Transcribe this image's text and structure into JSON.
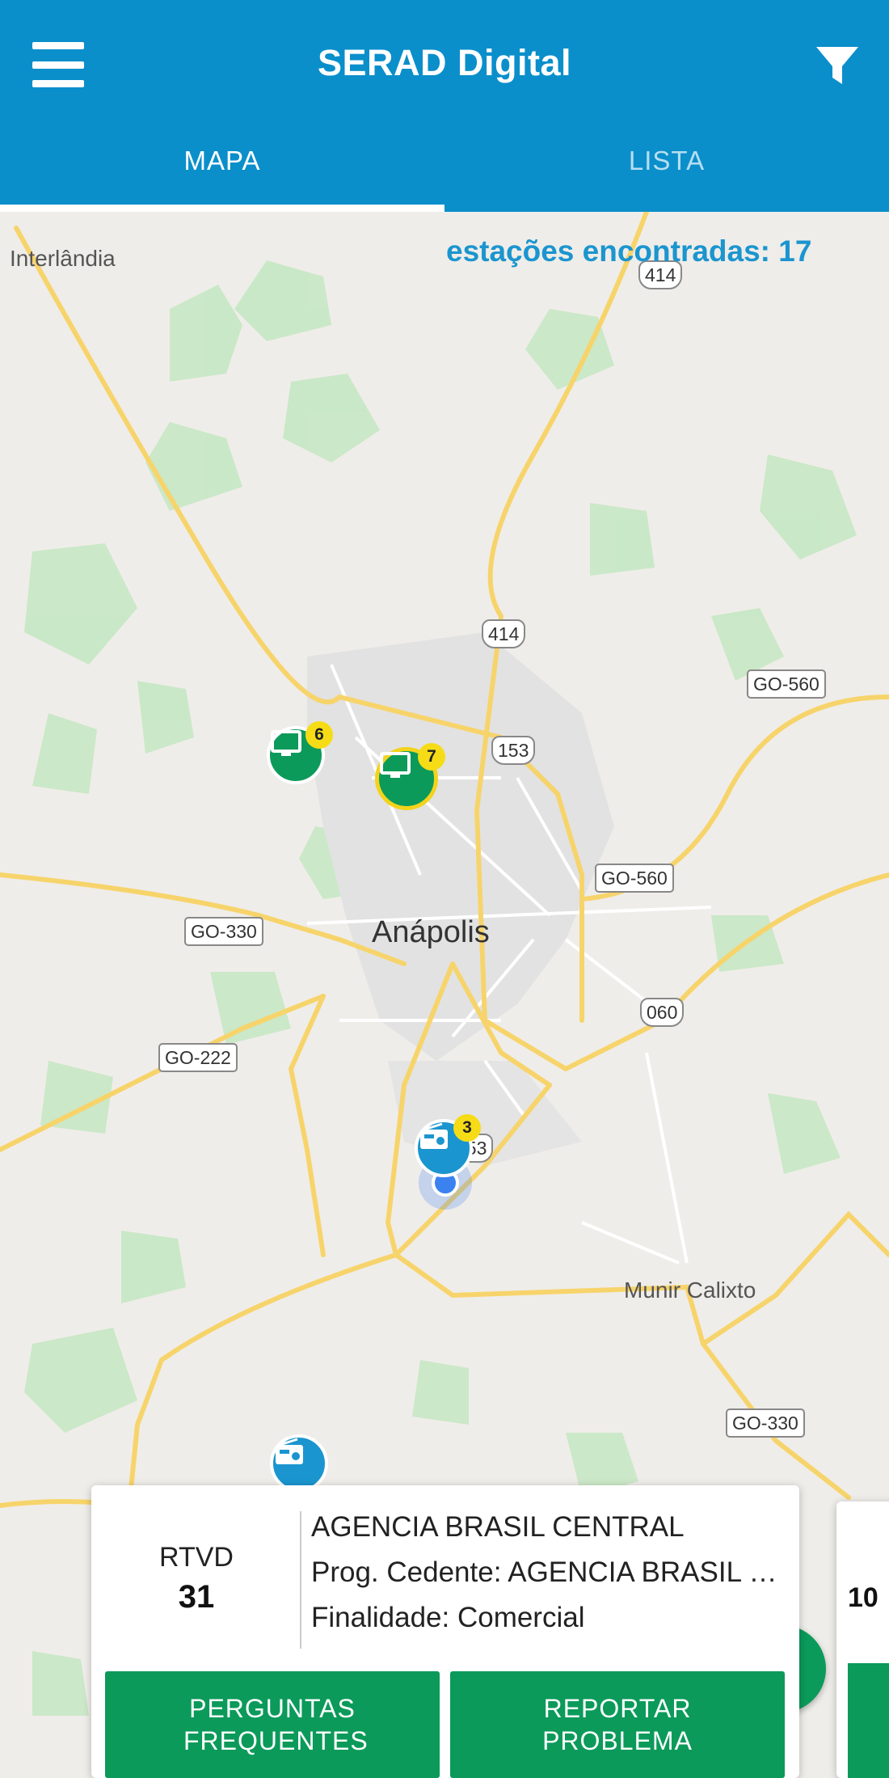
{
  "theme": {
    "primary": "#0a8fcb",
    "accent": "#1b95cf",
    "tv_green": "#0b9a5a",
    "badge_yellow": "#f6dc16"
  },
  "appbar": {
    "title": "SERAD Digital",
    "menu_icon": "hamburger-menu-icon",
    "filter_icon": "filter-funnel-icon",
    "tabs": [
      {
        "label": "MAPA",
        "active": true
      },
      {
        "label": "LISTA",
        "active": false
      }
    ]
  },
  "map": {
    "stations_found": "estações encontradas: 17",
    "place_labels": [
      "Interlândia",
      "Anápolis",
      "Munir Calixto"
    ],
    "road_shields": [
      "414",
      "414",
      "153",
      "GO-560",
      "GO-560",
      "GO-330",
      "060",
      "GO-222",
      "153",
      "GO-330"
    ],
    "markers": [
      {
        "type": "tv",
        "icon": "tv-icon",
        "count": "6"
      },
      {
        "type": "tv",
        "icon": "tv-icon",
        "count": "7",
        "selected": true
      },
      {
        "type": "radio",
        "icon": "radio-icon",
        "count": "3"
      },
      {
        "type": "radio",
        "icon": "radio-icon",
        "count": ""
      }
    ]
  },
  "station_card": {
    "type": "RTVD",
    "channel": "31",
    "name": "AGENCIA BRASIL CENTRAL",
    "prog_cedente": "Prog. Cedente: AGENCIA BRASIL CENTRAL",
    "finalidade": "Finalidade: Comercial",
    "faq_button": "PERGUNTAS FREQUENTES",
    "report_button": "REPORTAR PROBLEMA"
  },
  "next_card_peek": "10"
}
